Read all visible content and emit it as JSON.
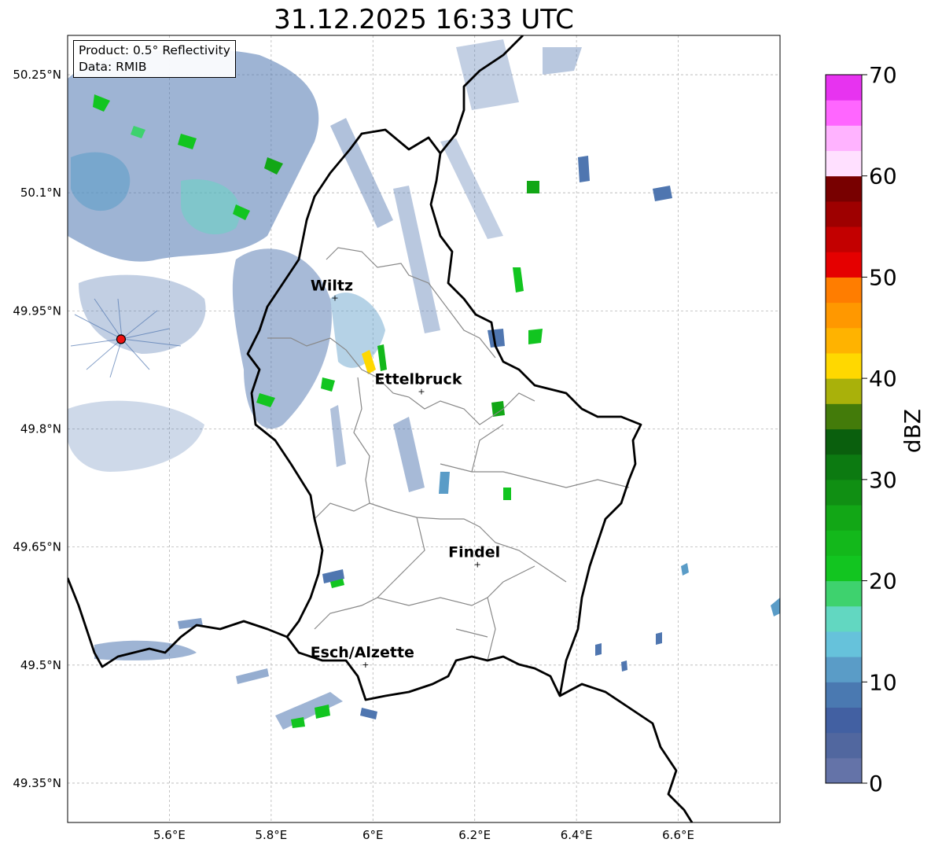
{
  "title": "31.12.2025 16:33 UTC",
  "info_box": {
    "product": "Product: 0.5° Reflectivity",
    "data": "Data: RMIB"
  },
  "map": {
    "lon_range": [
      5.4,
      6.8
    ],
    "lat_range": [
      49.3,
      50.3
    ],
    "lon_ticks": [
      {
        "value": 5.6,
        "label": "5.6°E"
      },
      {
        "value": 5.8,
        "label": "5.8°E"
      },
      {
        "value": 6.0,
        "label": "6°E"
      },
      {
        "value": 6.2,
        "label": "6.2°E"
      },
      {
        "value": 6.4,
        "label": "6.4°E"
      },
      {
        "value": 6.6,
        "label": "6.6°E"
      }
    ],
    "lat_ticks": [
      {
        "value": 50.25,
        "label": "50.25°N"
      },
      {
        "value": 50.1,
        "label": "50.1°N"
      },
      {
        "value": 49.95,
        "label": "49.95°N"
      },
      {
        "value": 49.8,
        "label": "49.8°N"
      },
      {
        "value": 49.65,
        "label": "49.65°N"
      },
      {
        "value": 49.5,
        "label": "49.5°N"
      },
      {
        "value": 49.35,
        "label": "49.35°N"
      }
    ],
    "grid": true,
    "cities": [
      {
        "name": "Wiltz",
        "lon": 5.93,
        "lat": 49.966
      },
      {
        "name": "Ettelbruck",
        "lon": 6.1,
        "lat": 49.847
      },
      {
        "name": "Findel",
        "lon": 6.21,
        "lat": 49.627
      },
      {
        "name": "Esch/Alzette",
        "lon": 5.99,
        "lat": 49.5
      }
    ],
    "radar_site": {
      "lon": 5.505,
      "lat": 49.914,
      "color": "#ee1111"
    }
  },
  "colorbar": {
    "label": "dBZ",
    "min": 0,
    "max": 70,
    "ticks": [
      {
        "value": 0,
        "label": "0"
      },
      {
        "value": 10,
        "label": "10"
      },
      {
        "value": 20,
        "label": "20"
      },
      {
        "value": 30,
        "label": "30"
      },
      {
        "value": 40,
        "label": "40"
      },
      {
        "value": 50,
        "label": "50"
      },
      {
        "value": 60,
        "label": "60"
      },
      {
        "value": 70,
        "label": "70"
      }
    ],
    "colors": [
      "#6473a8",
      "#51679f",
      "#4260a2",
      "#4a79b1",
      "#5a9cc7",
      "#66c2db",
      "#62d7c1",
      "#3ed26e",
      "#12c520",
      "#13b81b",
      "#12a716",
      "#108f13",
      "#0c7a11",
      "#0a5f0d",
      "#437b0a",
      "#a9b10a",
      "#ffd800",
      "#ffb300",
      "#ff9800",
      "#ff7d00",
      "#e50000",
      "#c30000",
      "#9e0000",
      "#780000",
      "#ffe0ff",
      "#ffb3ff",
      "#ff66ff",
      "#e733f0"
    ]
  }
}
